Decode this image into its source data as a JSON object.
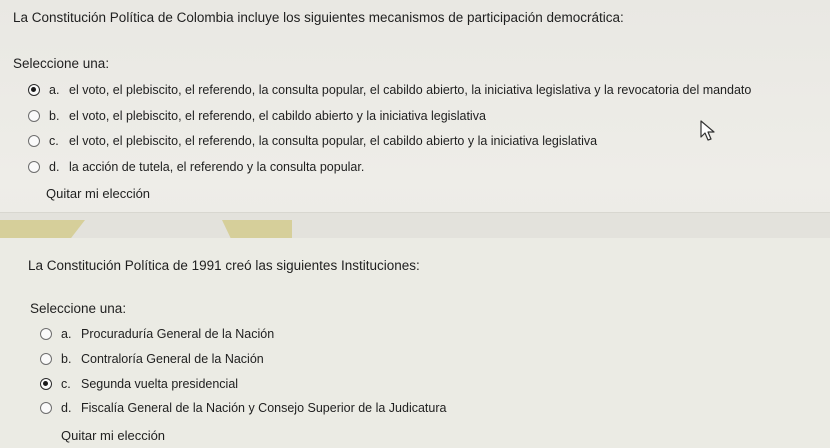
{
  "question1": {
    "text": "La Constitución Política de Colombia incluye los siguientes mecanismos de participación democrática:",
    "prompt": "Seleccione una:",
    "options": [
      {
        "letter": "a.",
        "label": "el voto, el plebiscito, el referendo, la consulta popular, el cabildo abierto, la iniciativa legislativa y la revocatoria del mandato",
        "checked": true
      },
      {
        "letter": "b.",
        "label": "el voto, el plebiscito, el referendo, el cabildo abierto y la iniciativa legislativa",
        "checked": false
      },
      {
        "letter": "c.",
        "label": "el voto, el plebiscito, el referendo, la consulta popular, el cabildo abierto y la iniciativa legislativa",
        "checked": false
      },
      {
        "letter": "d.",
        "label": "la acción de tutela, el referendo y la consulta popular.",
        "checked": false
      }
    ],
    "remove_label": "Quitar mi elección"
  },
  "question2": {
    "text": "La Constitución Política de 1991 creó las siguientes Instituciones:",
    "prompt": "Seleccione una:",
    "options": [
      {
        "letter": "a.",
        "label": "Procuraduría General de la Nación",
        "checked": false
      },
      {
        "letter": "b.",
        "label": "Contraloría General de la Nación",
        "checked": false
      },
      {
        "letter": "c.",
        "label": "Segunda vuelta presidencial",
        "checked": true
      },
      {
        "letter": "d.",
        "label": "Fiscalía General de la Nación y Consejo Superior de la Judicatura",
        "checked": false
      }
    ],
    "remove_label": "Quitar mi elección"
  },
  "icons": {
    "cursor": "mouse-pointer-icon"
  }
}
